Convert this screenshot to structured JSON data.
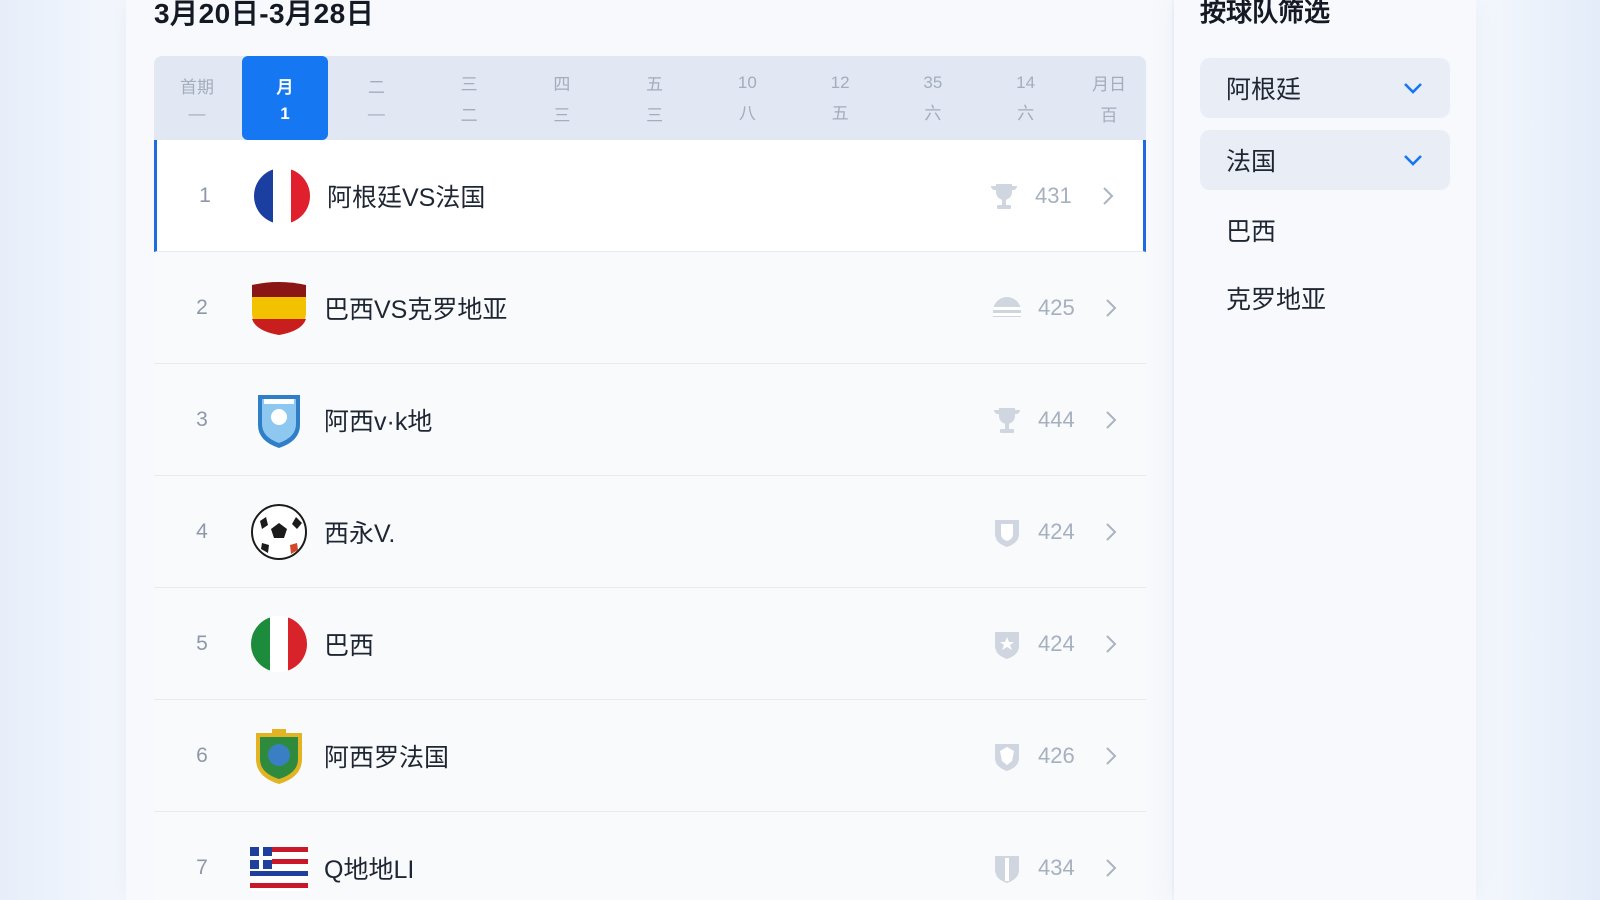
{
  "header": {
    "date_range": "3月20日-3月28日"
  },
  "days": [
    {
      "top": "首期",
      "bottom": "—"
    },
    {
      "top": "月",
      "bottom": "1",
      "active": true
    },
    {
      "top": "二",
      "bottom": "—"
    },
    {
      "top": "三",
      "bottom": "二"
    },
    {
      "top": "四",
      "bottom": "三"
    },
    {
      "top": "五",
      "bottom": "三"
    },
    {
      "top": "10",
      "bottom": "八"
    },
    {
      "top": "12",
      "bottom": "五"
    },
    {
      "top": "35",
      "bottom": "六"
    },
    {
      "top": "14",
      "bottom": "六"
    },
    {
      "top": "月日",
      "bottom": "百"
    }
  ],
  "matches": [
    {
      "rank": "1",
      "name": "阿根廷VS法国",
      "score": "431",
      "logo": "france-flag-icon",
      "badge": "trophy-icon"
    },
    {
      "rank": "2",
      "name": "巴西VS克罗地亚",
      "score": "425",
      "logo": "spain-flag-shield-icon",
      "badge": "helmet-icon"
    },
    {
      "rank": "3",
      "name": "阿西v·k地",
      "score": "444",
      "logo": "blue-crest-icon",
      "badge": "trophy-icon"
    },
    {
      "rank": "4",
      "name": "西永V.",
      "score": "424",
      "logo": "soccer-ball-icon",
      "badge": "shield-icon"
    },
    {
      "rank": "5",
      "name": "巴西",
      "score": "424",
      "logo": "italy-flag-icon",
      "badge": "shield-star-icon"
    },
    {
      "rank": "6",
      "name": "阿西罗法国",
      "score": "426",
      "logo": "green-crest-icon",
      "badge": "shield-icon"
    },
    {
      "rank": "7",
      "name": "Q地地LI",
      "score": "434",
      "logo": "striped-flag-icon",
      "badge": "shield-icon"
    }
  ],
  "sidebar": {
    "title": "按球队筛选",
    "filters": [
      {
        "label": "阿根廷",
        "icon": "chevron-down-icon"
      },
      {
        "label": "法国",
        "icon": "chevron-down-icon"
      }
    ],
    "options": [
      "巴西",
      "克罗地亚"
    ]
  },
  "colors": {
    "accent": "#1677f2",
    "selected_border": "#1e6be0",
    "muted": "#a6b0bf"
  }
}
